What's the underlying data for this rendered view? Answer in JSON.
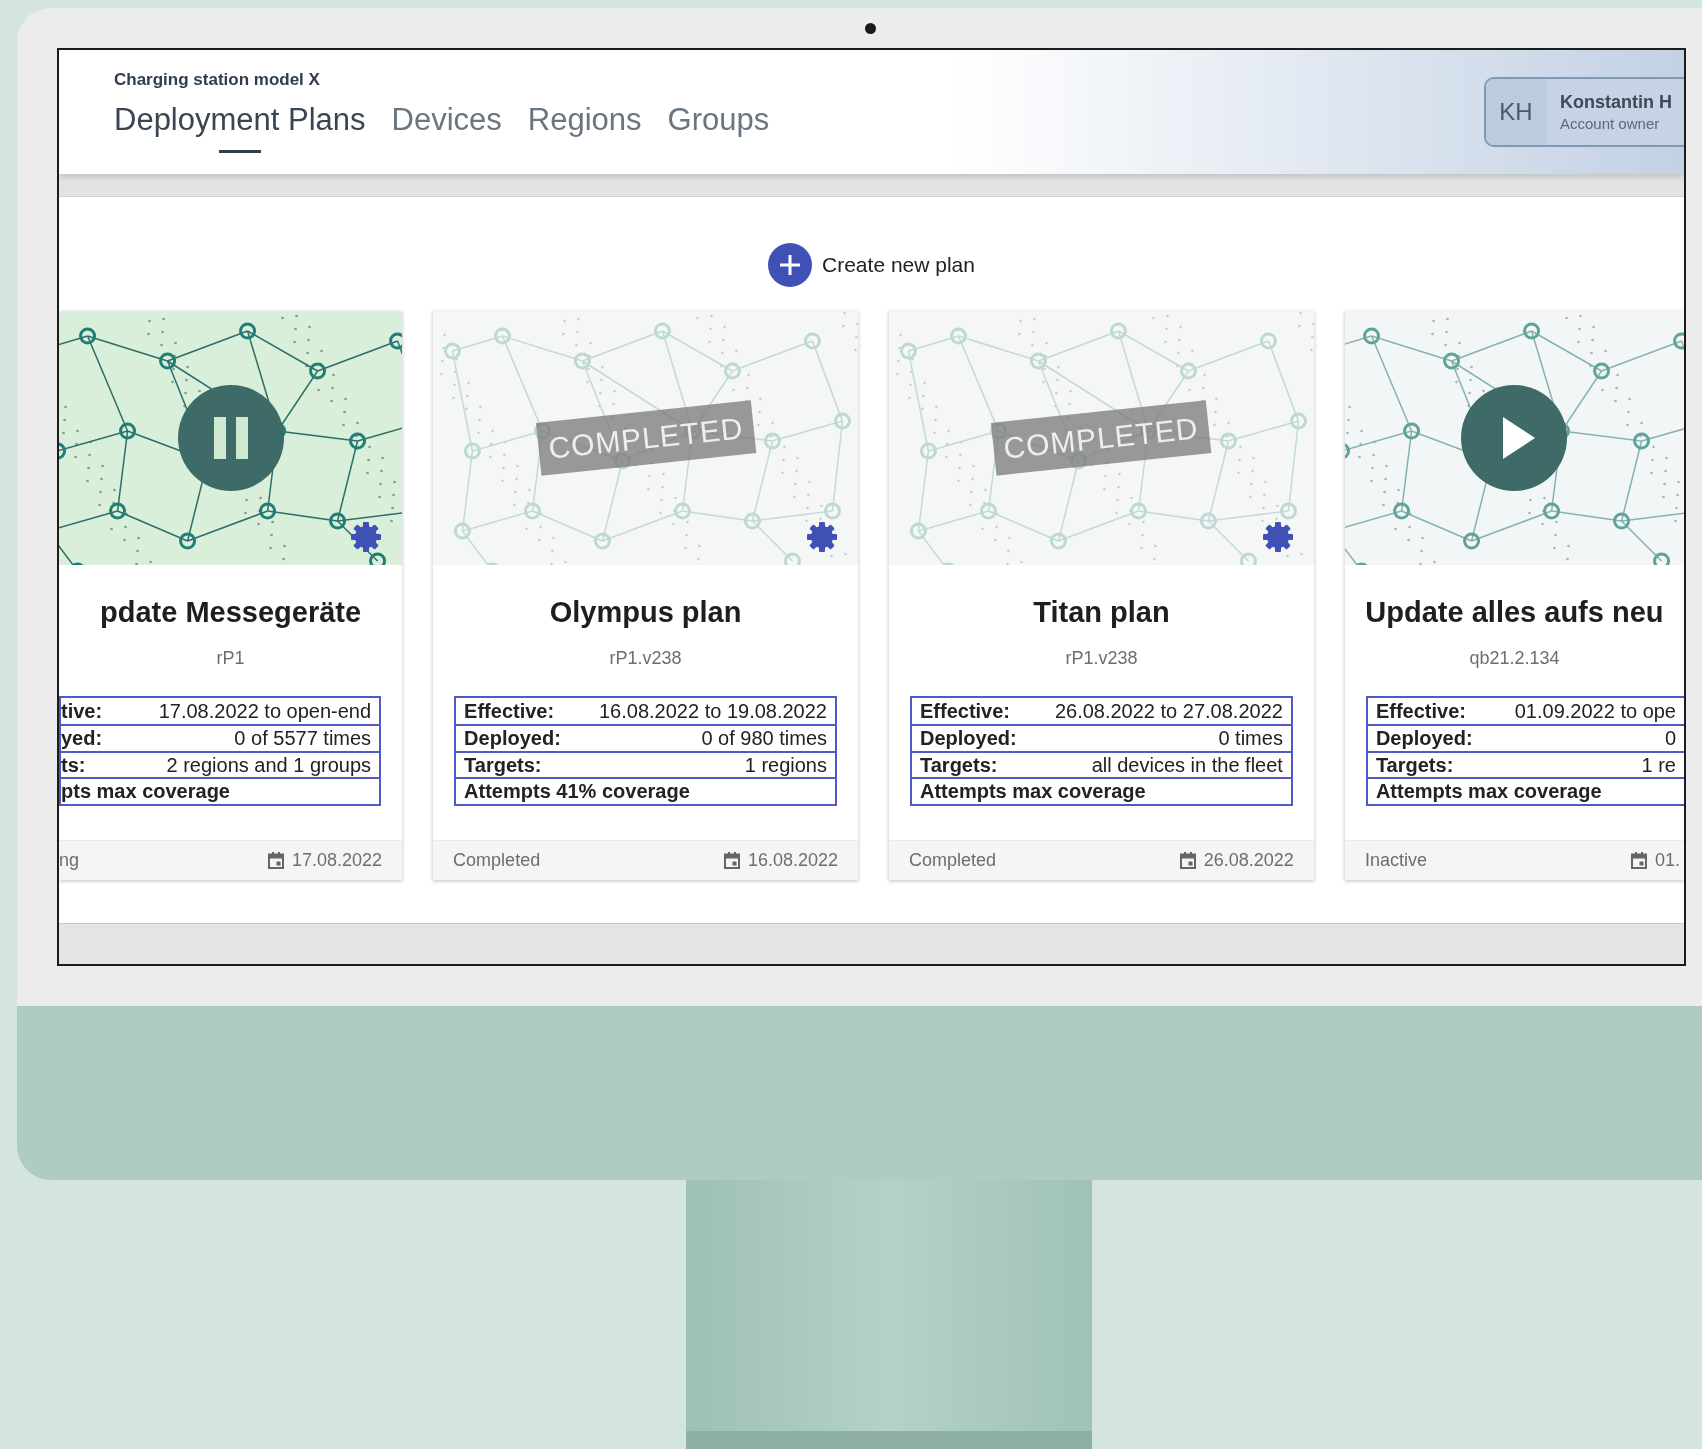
{
  "device": {
    "subtitle": "Charging station model X"
  },
  "tabs": [
    {
      "label": "Deployment Plans",
      "selected": true
    },
    {
      "label": "Devices",
      "selected": false
    },
    {
      "label": "Regions",
      "selected": false
    },
    {
      "label": "Groups",
      "selected": false
    }
  ],
  "user": {
    "initials": "KH",
    "name": "Konstantin H",
    "role": "Account owner"
  },
  "create_button": "Create new plan",
  "plans": [
    {
      "title": "pdate Messegeräte",
      "version": "rP1",
      "kind": "pause",
      "gear": true,
      "details": [
        {
          "kind": "pair",
          "label": "tive:",
          "value": "17.08.2022 to open-end"
        },
        {
          "kind": "pair",
          "label": "yed:",
          "value": "0 of 5577 times"
        },
        {
          "kind": "pair",
          "label": "ts:",
          "value": "2 regions and 1 groups"
        },
        {
          "kind": "note",
          "label": "pts max coverage"
        }
      ],
      "status": "ng",
      "date": "17.08.2022"
    },
    {
      "title": "Olympus plan",
      "version": "rP1.v238",
      "kind": "stamp",
      "stamp": "COMPLETED",
      "gear": true,
      "details": [
        {
          "kind": "pair",
          "label": "Effective:",
          "value": "16.08.2022 to 19.08.2022"
        },
        {
          "kind": "pair",
          "label": "Deployed:",
          "value": "0 of 980 times"
        },
        {
          "kind": "pair",
          "label": "Targets:",
          "value": "1 regions"
        },
        {
          "kind": "note",
          "label": "Attempts 41% coverage"
        }
      ],
      "status": "Completed",
      "date": "16.08.2022"
    },
    {
      "title": "Titan plan",
      "version": "rP1.v238",
      "kind": "stamp",
      "stamp": "COMPLETED",
      "gear": true,
      "details": [
        {
          "kind": "pair",
          "label": "Effective:",
          "value": "26.08.2022 to 27.08.2022"
        },
        {
          "kind": "pair",
          "label": "Deployed:",
          "value": "0 times"
        },
        {
          "kind": "pair",
          "label": "Targets:",
          "value": "all devices in the fleet"
        },
        {
          "kind": "note",
          "label": "Attempts max coverage"
        }
      ],
      "status": "Completed",
      "date": "26.08.2022"
    },
    {
      "title": "Update alles aufs neu",
      "version": "qb21.2.134",
      "kind": "play",
      "gear": false,
      "details": [
        {
          "kind": "pair",
          "label": "Effective:",
          "value": "01.09.2022 to ope"
        },
        {
          "kind": "pair",
          "label": "Deployed:",
          "value": "0"
        },
        {
          "kind": "pair",
          "label": "Targets:",
          "value": "1 re"
        },
        {
          "kind": "note",
          "label": "Attempts max coverage"
        }
      ],
      "status": "Inactive",
      "date": "01."
    }
  ]
}
